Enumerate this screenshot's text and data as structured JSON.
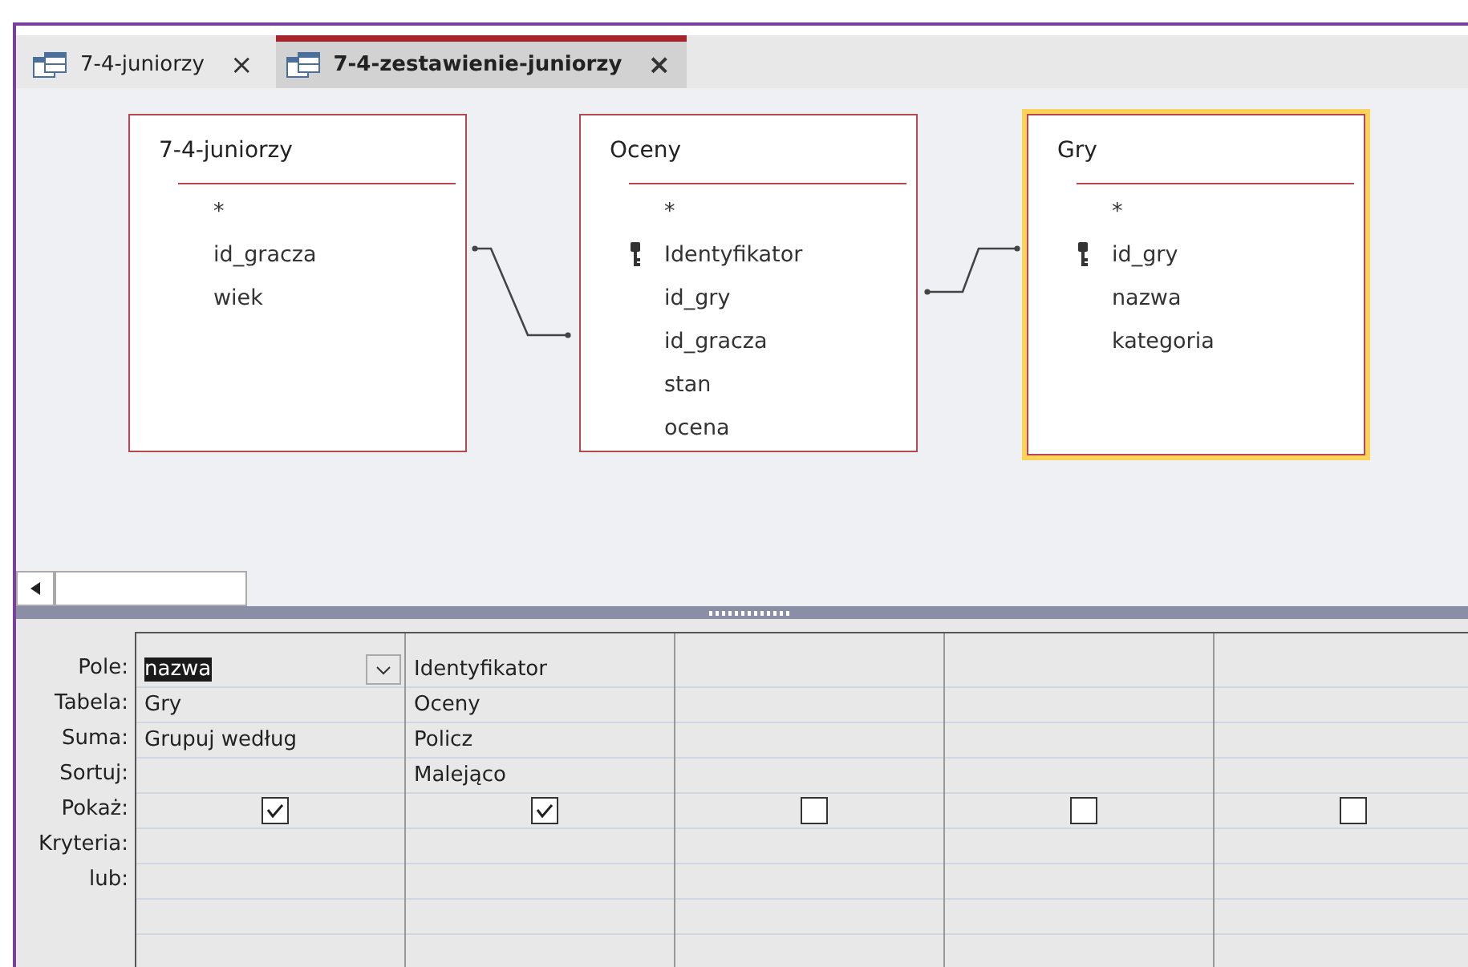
{
  "tabs": [
    {
      "label": "7-4-juniorzy",
      "selected": false,
      "close": "×"
    },
    {
      "label": "7-4-zestawienie-juniorzy",
      "selected": true,
      "close": "×"
    }
  ],
  "tables": [
    {
      "title": "7-4-juniorzy",
      "selected": false,
      "fields": [
        {
          "name": "*",
          "key": false
        },
        {
          "name": "id_gracza",
          "key": false
        },
        {
          "name": "wiek",
          "key": false
        }
      ]
    },
    {
      "title": "Oceny",
      "selected": false,
      "fields": [
        {
          "name": "*",
          "key": false
        },
        {
          "name": "Identyfikator",
          "key": true
        },
        {
          "name": "id_gry",
          "key": false
        },
        {
          "name": "id_gracza",
          "key": false
        },
        {
          "name": "stan",
          "key": false
        },
        {
          "name": "ocena",
          "key": false
        }
      ]
    },
    {
      "title": "Gry",
      "selected": true,
      "fields": [
        {
          "name": "*",
          "key": false
        },
        {
          "name": "id_gry",
          "key": true
        },
        {
          "name": "nazwa",
          "key": false
        },
        {
          "name": "kategoria",
          "key": false
        }
      ]
    }
  ],
  "grid": {
    "row_labels": [
      "Pole:",
      "Tabela:",
      "Suma:",
      "Sortuj:",
      "Pokaż:",
      "Kryteria:",
      "lub:"
    ],
    "columns": [
      {
        "field": "nazwa",
        "active": true,
        "table": "Gry",
        "total": "Grupuj według",
        "show": true
      },
      {
        "field": "Identyfikator",
        "active": false,
        "table": "Oceny",
        "total": "Policz",
        "sort": "Malejąco",
        "show": true
      },
      {
        "active": false,
        "show": false
      },
      {
        "active": false,
        "show": false
      },
      {
        "active": false,
        "show": false
      }
    ]
  }
}
